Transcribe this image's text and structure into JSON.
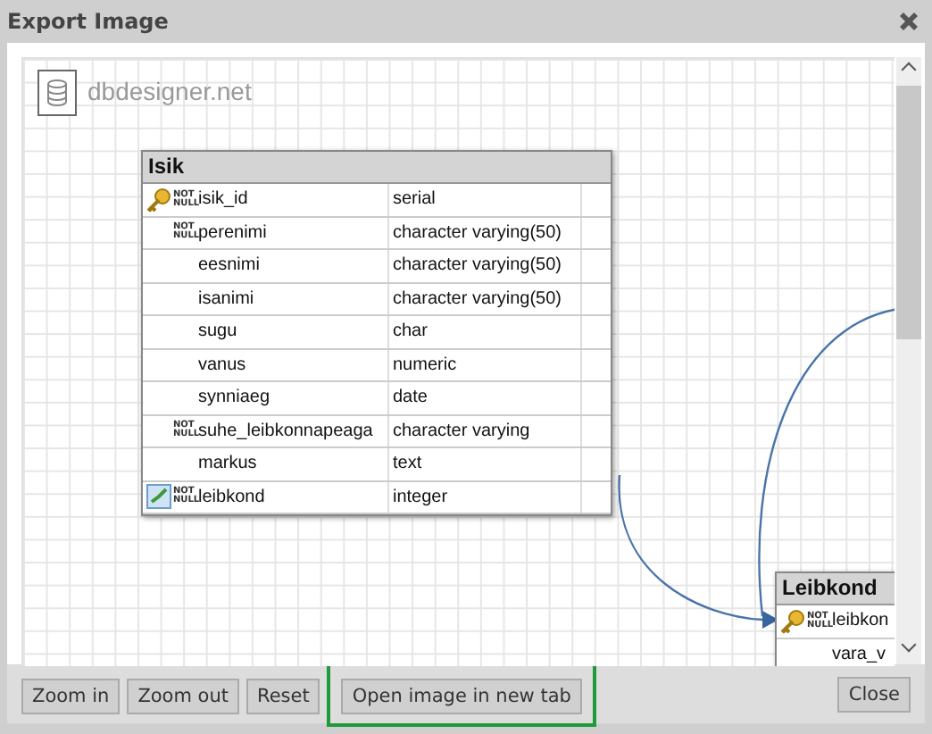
{
  "window": {
    "title": "Export Image"
  },
  "canvas": {
    "logo_text": "dbdesigner.net",
    "tables": [
      {
        "name": "Isik",
        "fields": [
          {
            "primary_key": true,
            "foreign_key": false,
            "badge": "NOT NULL",
            "name": "isik_id",
            "type": "serial"
          },
          {
            "primary_key": false,
            "foreign_key": false,
            "badge": "NOT NULL",
            "name": "perenimi",
            "type": "character varying(50)"
          },
          {
            "primary_key": false,
            "foreign_key": false,
            "name": "eesnimi",
            "type": "character varying(50)"
          },
          {
            "primary_key": false,
            "foreign_key": false,
            "name": "isanimi",
            "type": "character varying(50)"
          },
          {
            "primary_key": false,
            "foreign_key": false,
            "name": "sugu",
            "type": "char"
          },
          {
            "primary_key": false,
            "foreign_key": false,
            "name": "vanus",
            "type": "numeric"
          },
          {
            "primary_key": false,
            "foreign_key": false,
            "name": "synniaeg",
            "type": "date"
          },
          {
            "primary_key": false,
            "foreign_key": false,
            "badge": "NOT NULL",
            "name": "suhe_leibkonnapeaga",
            "type": "character varying"
          },
          {
            "primary_key": false,
            "foreign_key": false,
            "name": "markus",
            "type": "text"
          },
          {
            "primary_key": false,
            "foreign_key": true,
            "badge": "NOT NULL",
            "name": "leibkond",
            "type": "integer"
          }
        ]
      },
      {
        "name": "Leibkond",
        "fields": [
          {
            "primary_key": true,
            "foreign_key": false,
            "badge": "NOT NULL",
            "name": "leibkon"
          },
          {
            "primary_key": false,
            "foreign_key": false,
            "name": "vara_v"
          }
        ]
      }
    ]
  },
  "buttons": [
    {
      "label": "Zoom in",
      "highlighted": false
    },
    {
      "label": "Zoom out",
      "highlighted": false
    },
    {
      "label": "Reset",
      "highlighted": false
    },
    {
      "label": "Open image in new tab",
      "highlighted": true
    }
  ],
  "close_button": "Close"
}
